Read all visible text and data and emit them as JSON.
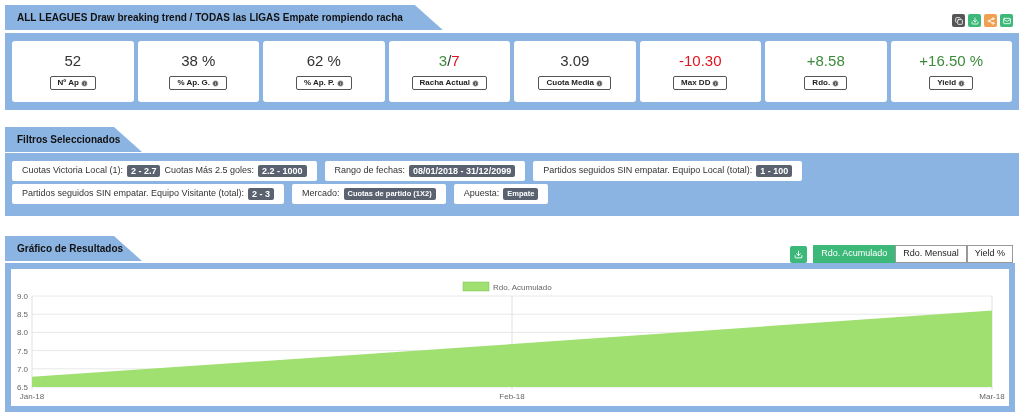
{
  "header": {
    "title": "ALL LEAGUES Draw breaking trend / TODAS las LIGAS Empate rompiendo racha"
  },
  "actions": [
    {
      "kind": "copy"
    },
    {
      "kind": "download"
    },
    {
      "kind": "share"
    },
    {
      "kind": "mail"
    }
  ],
  "stats": [
    {
      "parts": [
        {
          "text": "52",
          "color": "#333333"
        }
      ],
      "label": "Nº Ap"
    },
    {
      "parts": [
        {
          "text": "38 %",
          "color": "#333333"
        }
      ],
      "label": "% Ap. G."
    },
    {
      "parts": [
        {
          "text": "62 %",
          "color": "#333333"
        }
      ],
      "label": "% Ap. P."
    },
    {
      "parts": [
        {
          "text": "3",
          "color": "#3c8a3c"
        },
        {
          "text": "/",
          "color": "#333333"
        },
        {
          "text": "7",
          "color": "#e0141e"
        }
      ],
      "label": "Racha Actual"
    },
    {
      "parts": [
        {
          "text": "3.09",
          "color": "#333333"
        }
      ],
      "label": "Cuota Media"
    },
    {
      "parts": [
        {
          "text": "-10.30",
          "color": "#e0141e"
        }
      ],
      "label": "Max DD"
    },
    {
      "parts": [
        {
          "text": "+8.58",
          "color": "#3c8a3c"
        }
      ],
      "label": "Rdo."
    },
    {
      "parts": [
        {
          "text": "+16.50 %",
          "color": "#3c8a3c"
        }
      ],
      "label": "Yield"
    }
  ],
  "filters": {
    "title": "Filtros Seleccionados",
    "chips": [
      {
        "items": [
          {
            "label": "Cuotas Victoria Local (1):",
            "value": "2 - 2.7"
          },
          {
            "label": "Cuotas Más 2.5 goles:",
            "value": "2.2 - 1000"
          }
        ]
      },
      {
        "items": [
          {
            "label": "Rango de fechas:",
            "value": "08/01/2018 - 31/12/2099"
          }
        ]
      },
      {
        "items": [
          {
            "label": "Partidos seguidos SIN empatar. Equipo Local (total):",
            "value": "1 - 100"
          }
        ]
      },
      {
        "items": [
          {
            "label": "Partidos seguidos SIN empatar. Equipo Visitante (total):",
            "value": "2 - 3"
          }
        ]
      },
      {
        "items": [
          {
            "label": "Mercado:",
            "value": "Cuotas de partido (1X2)",
            "small": true
          }
        ]
      },
      {
        "items": [
          {
            "label": "Apuesta:",
            "value": "Empate",
            "small": true
          }
        ]
      }
    ]
  },
  "results": {
    "title": "Gráfico de Resultados",
    "tabs": [
      {
        "label": "Rdo. Acumulado",
        "selected": true
      },
      {
        "label": "Rdo. Mensual",
        "selected": false
      },
      {
        "label": "Yield %",
        "selected": false
      }
    ],
    "chart_data": {
      "type": "area",
      "categories": [
        "Jan-18",
        "Feb-18",
        "Mar-18"
      ],
      "series": [
        {
          "name": "Rdo. Acumulado",
          "color": "#a0e070",
          "values": [
            6.78,
            7.68,
            8.6
          ]
        }
      ],
      "grid": true,
      "ylim": [
        6.5,
        9.0
      ],
      "yticks": [
        {
          "value": 6.5,
          "label": "6.5"
        },
        {
          "value": 7.0,
          "label": "7.0"
        },
        {
          "value": 7.5,
          "label": "7.5"
        },
        {
          "value": 8.0,
          "label": "8.0"
        },
        {
          "value": 8.5,
          "label": "8.5"
        },
        {
          "value": 9.0,
          "label": "9.0"
        }
      ]
    }
  }
}
